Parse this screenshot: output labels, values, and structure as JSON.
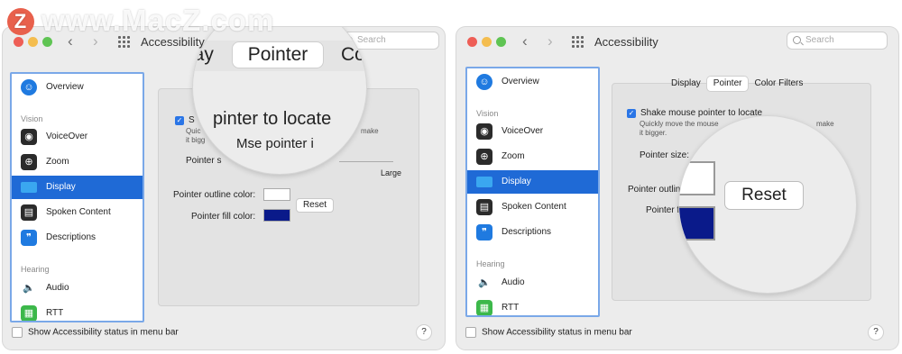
{
  "watermark": {
    "text": "www.MacZ.com",
    "logo": "Z"
  },
  "left": {
    "title": "Accessibility",
    "search_placeholder": "Search",
    "sidebar": {
      "items": [
        {
          "label": "Overview",
          "icon": "accessibility-icon"
        },
        {
          "label": "VoiceOver",
          "icon": "voiceover-icon"
        },
        {
          "label": "Zoom",
          "icon": "zoom-icon"
        },
        {
          "label": "Display",
          "icon": "display-icon"
        },
        {
          "label": "Spoken Content",
          "icon": "speech-icon"
        },
        {
          "label": "Descriptions",
          "icon": "descriptions-icon"
        },
        {
          "label": "Audio",
          "icon": "speaker-icon"
        },
        {
          "label": "RTT",
          "icon": "rtt-icon"
        }
      ],
      "headings": {
        "vision": "Vision",
        "hearing": "Hearing"
      }
    },
    "panel": {
      "checkbox_partial": "S",
      "desc_line1": "Quic",
      "desc_make": "make",
      "desc_line2": "it bigg",
      "pointer_size_partial": "Pointer s",
      "large": "Large",
      "outline_label": "Pointer outline color:",
      "fill_label": "Pointer fill color:",
      "reset": "Reset"
    },
    "lens": {
      "tab1": "lay",
      "tab2": "Pointer",
      "tab3": "Co",
      "line1": "pinter to locate",
      "line2": "Mse pointer i"
    },
    "bottom_label": "Show Accessibility status in menu bar",
    "help": "?"
  },
  "right": {
    "title": "Accessibility",
    "search_placeholder": "Search",
    "sidebar": {
      "items": [
        {
          "label": "Overview",
          "icon": "accessibility-icon"
        },
        {
          "label": "VoiceOver",
          "icon": "voiceover-icon"
        },
        {
          "label": "Zoom",
          "icon": "zoom-icon"
        },
        {
          "label": "Display",
          "icon": "display-icon"
        },
        {
          "label": "Spoken Content",
          "icon": "speech-icon"
        },
        {
          "label": "Descriptions",
          "icon": "descriptions-icon"
        },
        {
          "label": "Audio",
          "icon": "speaker-icon"
        },
        {
          "label": "RTT",
          "icon": "rtt-icon"
        }
      ],
      "headings": {
        "vision": "Vision",
        "hearing": "Hearing"
      }
    },
    "tabs": [
      "Display",
      "Pointer",
      "Color Filters"
    ],
    "panel": {
      "checkbox_label": "Shake mouse pointer to locate",
      "desc_line1": "Quickly move the mouse",
      "desc_make": "make",
      "desc_line2": "it bigger.",
      "pointer_size": "Pointer size:",
      "outline_partial": "Pointer outline",
      "fill_partial": "Pointer fi"
    },
    "lens": {
      "reset": "Reset"
    },
    "bottom_label": "Show Accessibility status in menu bar",
    "help": "?"
  },
  "colors": {
    "selection": "#1f6ad6",
    "fill_color": "#0a1a8a",
    "sidebar_border": "#7aa8e8"
  }
}
